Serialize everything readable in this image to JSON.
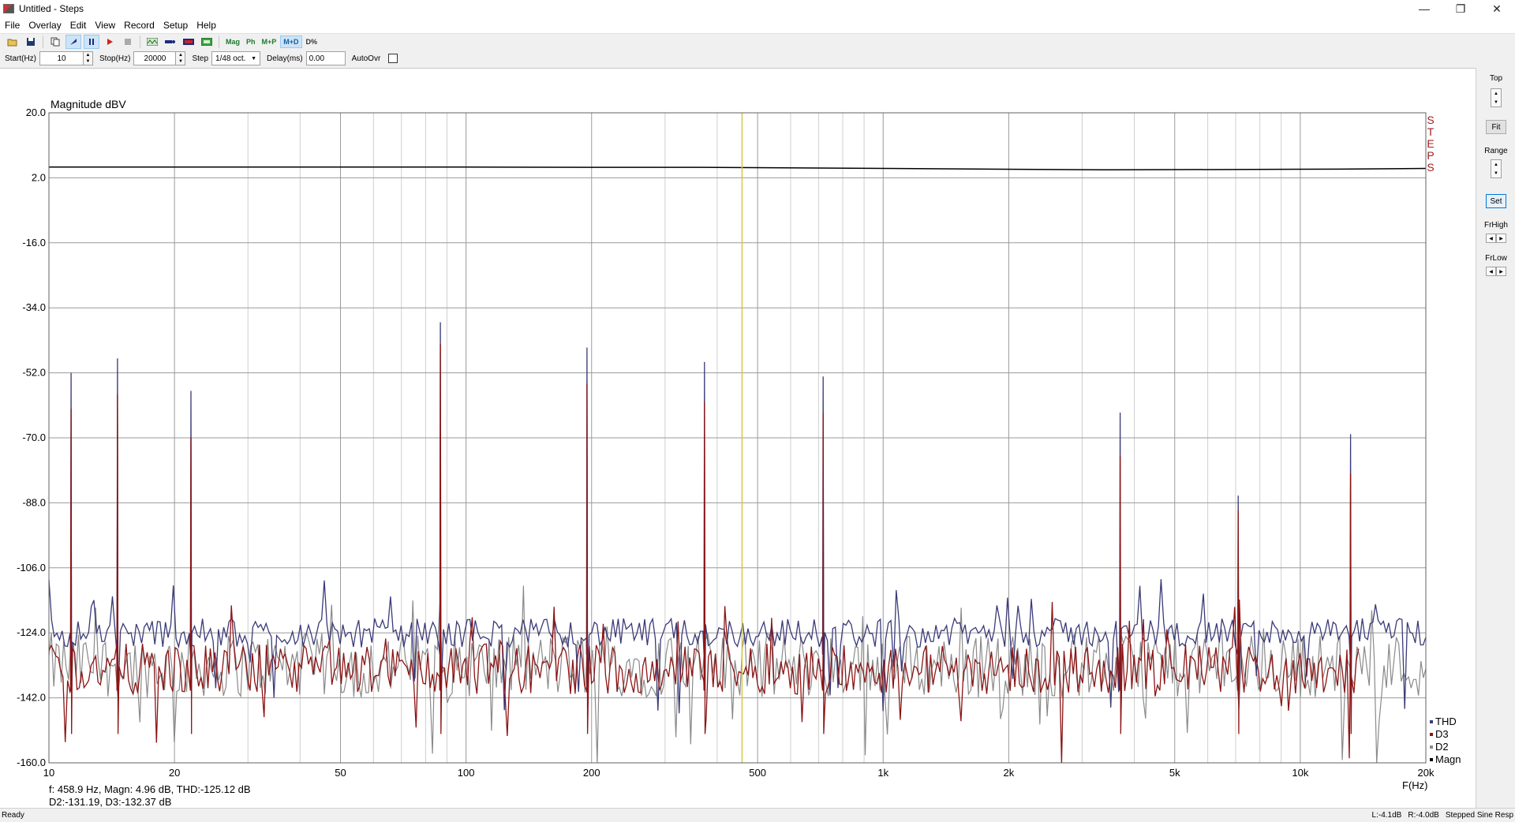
{
  "window": {
    "title": "Untitled - Steps",
    "minimize": "—",
    "restore": "❐",
    "close": "✕"
  },
  "menu": [
    "File",
    "Overlay",
    "Edit",
    "View",
    "Record",
    "Setup",
    "Help"
  ],
  "toolbar": {
    "mag": "Mag",
    "ph": "Ph",
    "mp": "M+P",
    "md": "M+D",
    "pct": "D%"
  },
  "params": {
    "start_label": "Start(Hz)",
    "start_value": "10",
    "stop_label": "Stop(Hz)",
    "stop_value": "20000",
    "step_label": "Step",
    "step_value": "1/48 oct.",
    "delay_label": "Delay(ms)",
    "delay_value": "0.00",
    "autoovr_label": "AutoOvr"
  },
  "rightpanel": {
    "top": "Top",
    "fit": "Fit",
    "range": "Range",
    "set": "Set",
    "frhigh": "FrHigh",
    "frlow": "FrLow"
  },
  "plot": {
    "ylabel": "Magnitude dBV",
    "xlabel": "F(Hz)",
    "brand": [
      "S",
      "T",
      "E",
      "P",
      "S"
    ],
    "readout1": "f:  458.9 Hz, Magn: 4.96 dB, THD:-125.12  dB",
    "readout2": "D2:-131.19, D3:-132.37 dB",
    "legend": [
      "THD",
      "D3",
      "D2",
      "Magn"
    ]
  },
  "chart_data": {
    "type": "line",
    "xscale": "log",
    "xlim": [
      10,
      20000
    ],
    "ylim": [
      -160,
      20
    ],
    "y_ticks": [
      20.0,
      2.0,
      -16.0,
      -34.0,
      -52.0,
      -70.0,
      -88.0,
      -106.0,
      -124.0,
      -142.0,
      -160.0
    ],
    "y_tick_labels": [
      "20.0",
      "2.0",
      "-16.0",
      "-34.0",
      "-52.0",
      "-70.0",
      "-88.0",
      "-106.0",
      "-124.0",
      "-142.0",
      "-160.0"
    ],
    "x_ticks": [
      10,
      20,
      50,
      100,
      200,
      500,
      1000,
      2000,
      5000,
      10000,
      20000
    ],
    "x_tick_labels": [
      "10",
      "20",
      "50",
      "100",
      "200",
      "500",
      "1k",
      "2k",
      "5k",
      "10k",
      "20k"
    ],
    "cursor_hz": 458.9,
    "colors": {
      "THD": "#3a3a78",
      "D3": "#8b1414",
      "D2": "#8a8a8a",
      "Magn": "#000000",
      "cursor": "#d4c84a"
    },
    "series": [
      {
        "name": "Magn",
        "x": [
          10,
          100,
          200,
          350,
          700,
          3500,
          12500,
          20000
        ],
        "y": [
          4.96,
          4.96,
          4.9,
          4.9,
          4.7,
          4.2,
          4.4,
          4.6
        ]
      },
      {
        "name": "THD",
        "spikes_hz": [
          11.3,
          14.6,
          21.9,
          86.8,
          195,
          373,
          718,
          3700,
          7100,
          13200
        ],
        "spikes_db": [
          -52,
          -48,
          -57,
          -38,
          -45,
          -49,
          -53,
          -63,
          -86,
          -69
        ],
        "floor_db": -124,
        "x_end": 20000
      },
      {
        "name": "D3",
        "spikes_hz": [
          11.3,
          14.6,
          21.9,
          86.8,
          195,
          373,
          718,
          3700,
          7100,
          13200
        ],
        "spikes_db": [
          -62,
          -58,
          -70,
          -44,
          -55,
          -60,
          -63,
          -75,
          -90,
          -80
        ],
        "floor_db": -134,
        "x_end": 13800
      },
      {
        "name": "D2",
        "floor_db": -133,
        "x_end": 20000
      }
    ]
  },
  "status": {
    "left": "Ready",
    "l": "L:-4.1dB",
    "r": "R:-4.0dB",
    "mode": "Stepped Sine Resp"
  }
}
